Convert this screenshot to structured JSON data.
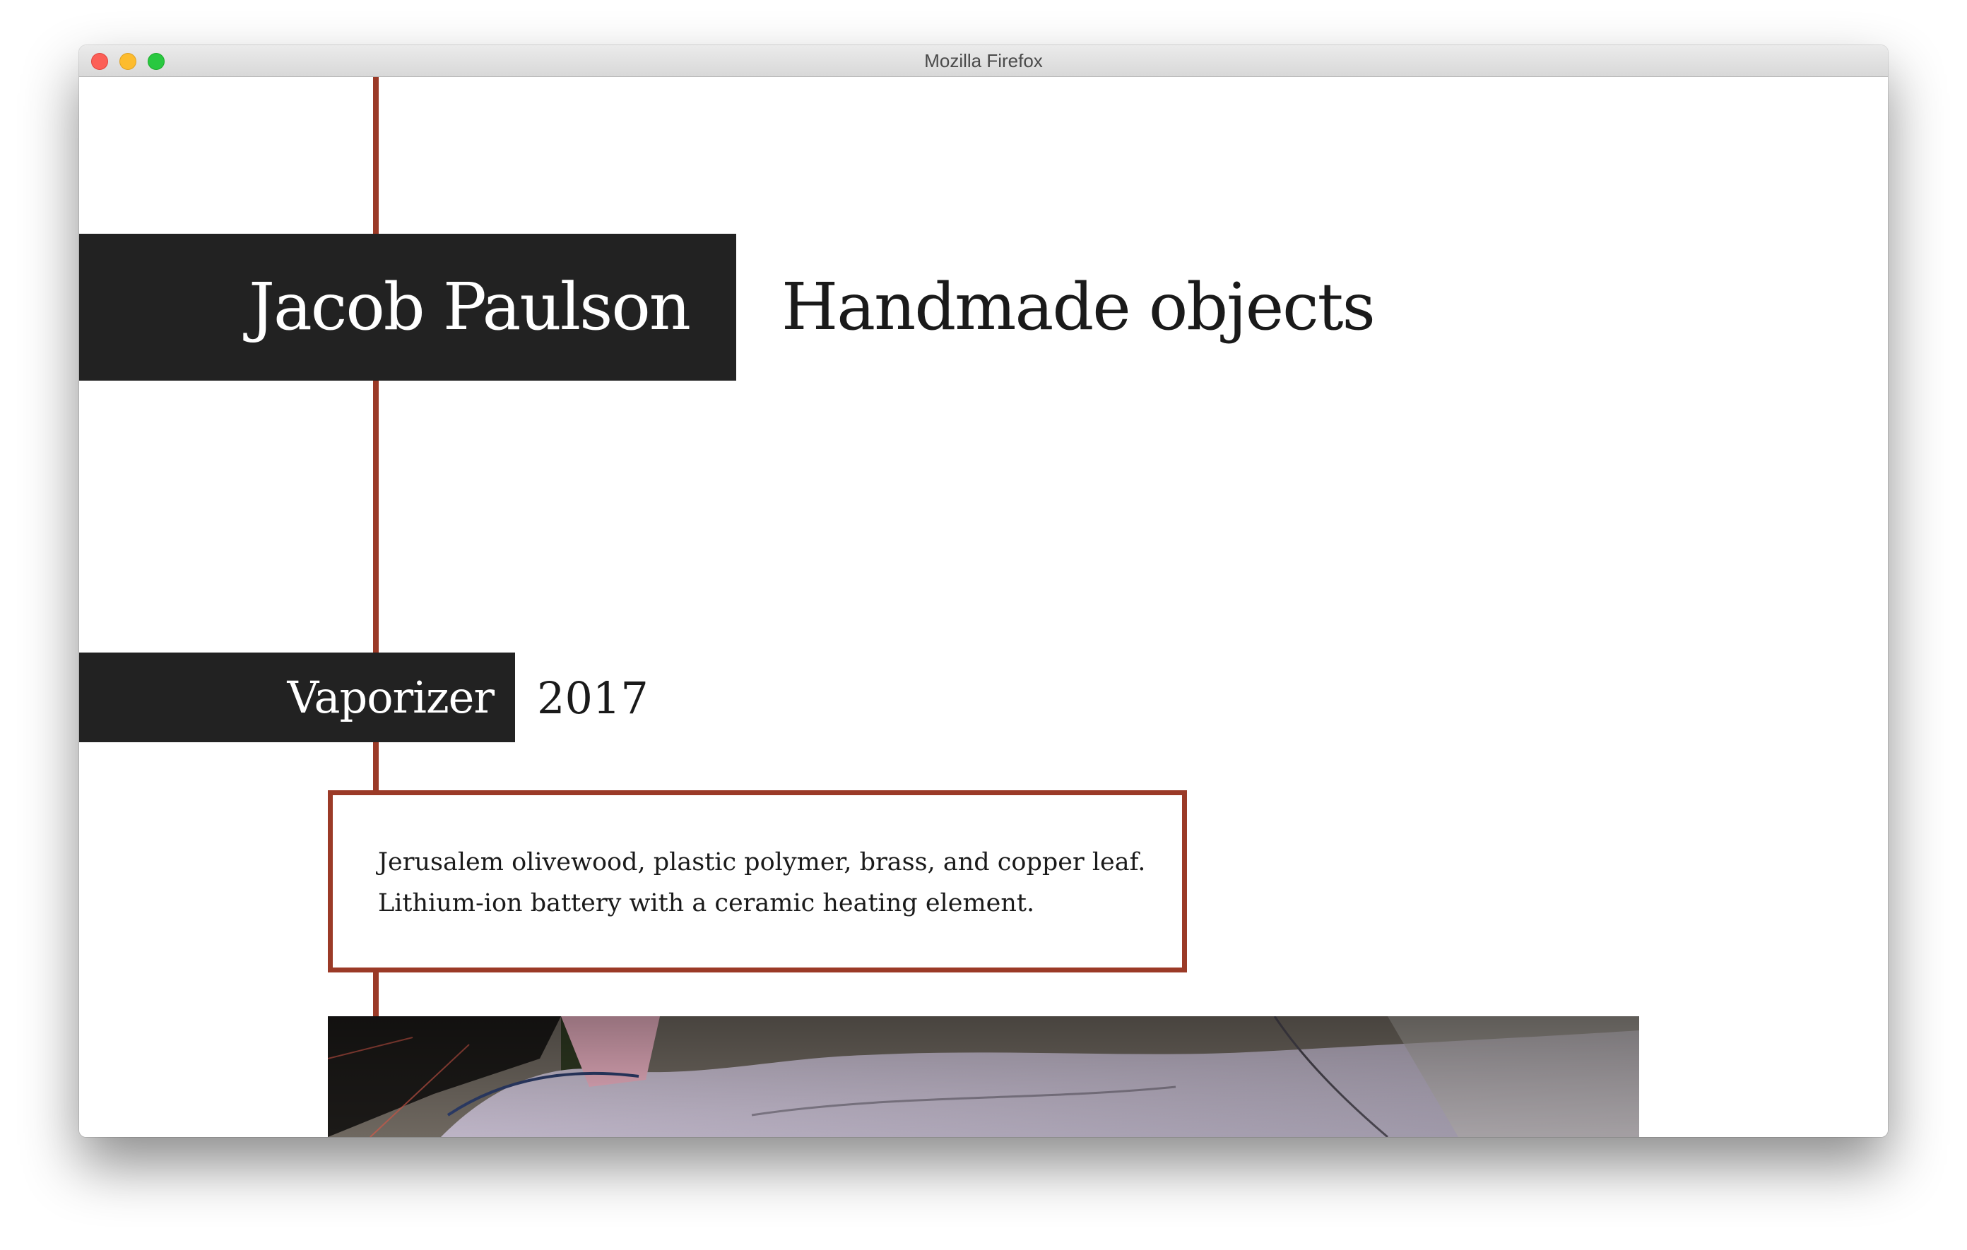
{
  "window": {
    "title": "Mozilla Firefox"
  },
  "header": {
    "name": "Jacob Paulson",
    "tagline": "Handmade objects"
  },
  "project": {
    "title": "Vaporizer",
    "year": "2017",
    "description": "Jerusalem olivewood, plastic polymer, brass, and copper leaf. Lithium-ion battery with a ceramic heating element."
  },
  "colors": {
    "accent": "#9b3a27",
    "block": "#222222",
    "text": "#1a1a1a",
    "background": "#ffffff"
  }
}
